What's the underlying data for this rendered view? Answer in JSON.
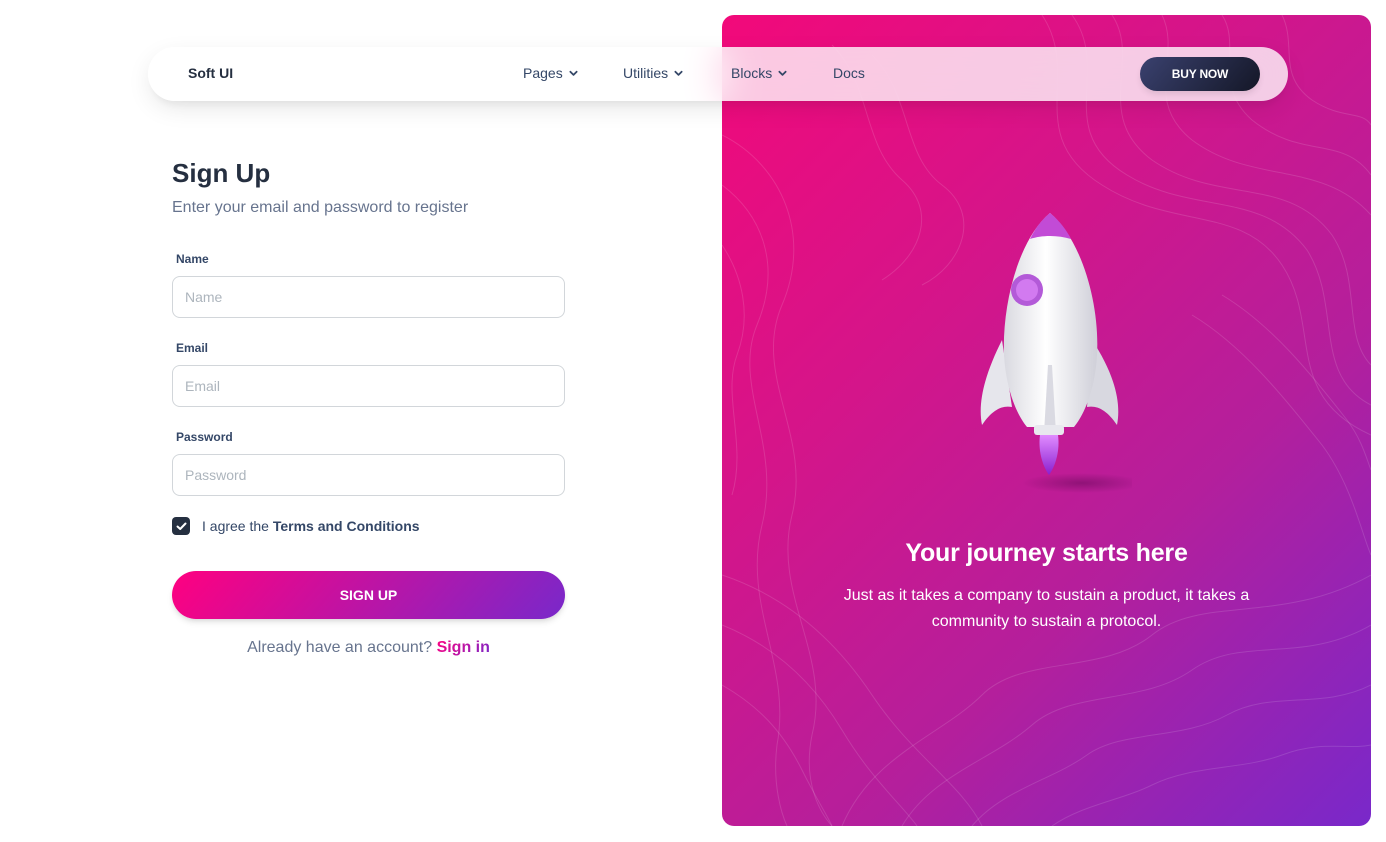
{
  "navbar": {
    "brand": "Soft UI",
    "items": [
      {
        "label": "Pages",
        "has_dropdown": true
      },
      {
        "label": "Utilities",
        "has_dropdown": true
      },
      {
        "label": "Blocks",
        "has_dropdown": true
      },
      {
        "label": "Docs",
        "has_dropdown": false
      }
    ],
    "cta_label": "BUY NOW"
  },
  "form": {
    "title": "Sign Up",
    "subtitle": "Enter your email and password to register",
    "fields": [
      {
        "label": "Name",
        "placeholder": "Name",
        "value": ""
      },
      {
        "label": "Email",
        "placeholder": "Email",
        "value": ""
      },
      {
        "label": "Password",
        "placeholder": "Password",
        "value": ""
      }
    ],
    "agree_prefix": "I agree the",
    "agree_terms": "Terms and Conditions",
    "agree_checked": true,
    "submit_label": "SIGN UP",
    "signin_prompt": "Already have an account?",
    "signin_link": "Sign in"
  },
  "hero": {
    "title": "Your journey starts here",
    "text": "Just as it takes a company to sustain a product, it takes a community to sustain a protocol.",
    "image": "rocket-illustration"
  },
  "colors": {
    "primary_gradient_start": "#ff0080",
    "primary_gradient_end": "#7928ca",
    "dark": "#252f40",
    "text_muted": "#67748e"
  },
  "icons": {
    "dropdown": "chevron-down-icon",
    "checkbox": "check-icon"
  }
}
